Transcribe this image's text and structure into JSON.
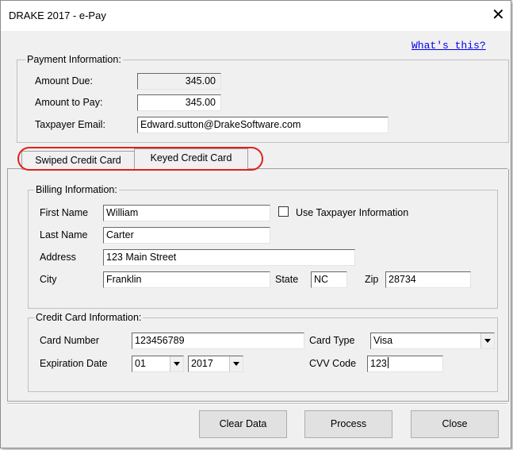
{
  "window": {
    "title": "DRAKE 2017 - e-Pay",
    "close_glyph": "✕"
  },
  "help_link": "What's this?",
  "payment": {
    "legend": "Payment Information:",
    "amount_due_label": "Amount Due:",
    "amount_due": "345.00",
    "amount_to_pay_label": "Amount to Pay:",
    "amount_to_pay": "345.00",
    "email_label": "Taxpayer Email:",
    "email": "Edward.sutton@DrakeSoftware.com"
  },
  "tabs": [
    {
      "label": "Swiped Credit Card",
      "active": false
    },
    {
      "label": "Keyed Credit Card",
      "active": true
    }
  ],
  "highlight_color": "#e0201c",
  "billing": {
    "legend": "Billing Information:",
    "first_name_label": "First Name",
    "first_name": "William",
    "use_taxpayer_label": "Use Taxpayer Information",
    "use_taxpayer_checked": false,
    "last_name_label": "Last Name",
    "last_name": "Carter",
    "address_label": "Address",
    "address": "123 Main Street",
    "city_label": "City",
    "city": "Franklin",
    "state_label": "State",
    "state": "NC",
    "zip_label": "Zip",
    "zip": "28734"
  },
  "card": {
    "legend": "Credit Card Information:",
    "number_label": "Card Number",
    "number": "123456789",
    "type_label": "Card Type",
    "type": "Visa",
    "expiration_label": "Expiration Date",
    "exp_month": "01",
    "exp_year": "2017",
    "cvv_label": "CVV Code",
    "cvv": "123"
  },
  "buttons": {
    "clear": "Clear Data",
    "process": "Process",
    "close": "Close"
  }
}
